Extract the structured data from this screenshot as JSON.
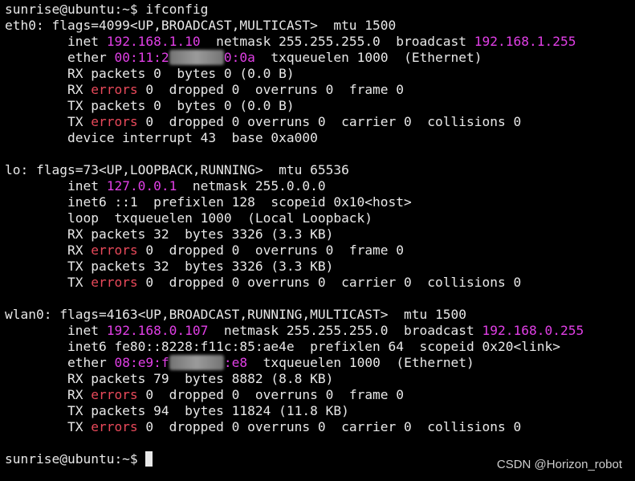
{
  "window": {
    "background": "#000000",
    "text_color": "#e8e8e8",
    "highlight_ip_color": "#e13fe6",
    "highlight_error_color": "#e8495a"
  },
  "terminal": {
    "lines": [
      [
        {
          "t": "sunrise@ubuntu:~$ ifconfig",
          "c": ""
        }
      ],
      [
        {
          "t": "eth0: flags=4099<UP,BROADCAST,MULTICAST>  mtu 1500",
          "c": ""
        }
      ],
      [
        {
          "t": "        inet ",
          "c": ""
        },
        {
          "t": "192.168.1.10",
          "c": "pink"
        },
        {
          "t": "  netmask 255.255.255.0  broadcast ",
          "c": ""
        },
        {
          "t": "192.168.1.255",
          "c": "pink"
        }
      ],
      [
        {
          "t": "        ether ",
          "c": ""
        },
        {
          "t": "00:11:2",
          "c": "pink"
        },
        {
          "t": "#######",
          "c": "redacted"
        },
        {
          "t": "0:0a",
          "c": "pink"
        },
        {
          "t": "  txqueuelen 1000  (Ethernet)",
          "c": ""
        }
      ],
      [
        {
          "t": "        RX packets 0  bytes 0 (0.0 B)",
          "c": ""
        }
      ],
      [
        {
          "t": "        RX ",
          "c": ""
        },
        {
          "t": "errors",
          "c": "red"
        },
        {
          "t": " 0  dropped 0  overruns 0  frame 0",
          "c": ""
        }
      ],
      [
        {
          "t": "        TX packets 0  bytes 0 (0.0 B)",
          "c": ""
        }
      ],
      [
        {
          "t": "        TX ",
          "c": ""
        },
        {
          "t": "errors",
          "c": "red"
        },
        {
          "t": " 0  dropped 0 overruns 0  carrier 0  collisions 0",
          "c": ""
        }
      ],
      [
        {
          "t": "        device interrupt 43  base 0xa000",
          "c": ""
        }
      ],
      [
        {
          "t": "",
          "c": ""
        }
      ],
      [
        {
          "t": "lo: flags=73<UP,LOOPBACK,RUNNING>  mtu 65536",
          "c": ""
        }
      ],
      [
        {
          "t": "        inet ",
          "c": ""
        },
        {
          "t": "127.0.0.1",
          "c": "pink"
        },
        {
          "t": "  netmask 255.0.0.0",
          "c": ""
        }
      ],
      [
        {
          "t": "        inet6 ::1  prefixlen 128  scopeid 0x10<host>",
          "c": ""
        }
      ],
      [
        {
          "t": "        loop  txqueuelen 1000  (Local Loopback)",
          "c": ""
        }
      ],
      [
        {
          "t": "        RX packets 32  bytes 3326 (3.3 KB)",
          "c": ""
        }
      ],
      [
        {
          "t": "        RX ",
          "c": ""
        },
        {
          "t": "errors",
          "c": "red"
        },
        {
          "t": " 0  dropped 0  overruns 0  frame 0",
          "c": ""
        }
      ],
      [
        {
          "t": "        TX packets 32  bytes 3326 (3.3 KB)",
          "c": ""
        }
      ],
      [
        {
          "t": "        TX ",
          "c": ""
        },
        {
          "t": "errors",
          "c": "red"
        },
        {
          "t": " 0  dropped 0 overruns 0  carrier 0  collisions 0",
          "c": ""
        }
      ],
      [
        {
          "t": "",
          "c": ""
        }
      ],
      [
        {
          "t": "wlan0: flags=4163<UP,BROADCAST,RUNNING,MULTICAST>  mtu 1500",
          "c": ""
        }
      ],
      [
        {
          "t": "        inet ",
          "c": ""
        },
        {
          "t": "192.168.0.107",
          "c": "pink"
        },
        {
          "t": "  netmask 255.255.255.0  broadcast ",
          "c": ""
        },
        {
          "t": "192.168.0.255",
          "c": "pink"
        }
      ],
      [
        {
          "t": "        inet6 fe80::8228:f11c:85:ae4e  prefixlen 64  scopeid 0x20<link>",
          "c": ""
        }
      ],
      [
        {
          "t": "        ether ",
          "c": ""
        },
        {
          "t": "08:e9:f",
          "c": "pink"
        },
        {
          "t": "#######",
          "c": "redacted"
        },
        {
          "t": ":e8",
          "c": "pink"
        },
        {
          "t": "  txqueuelen 1000  (Ethernet)",
          "c": ""
        }
      ],
      [
        {
          "t": "        RX packets 79  bytes 8882 (8.8 KB)",
          "c": ""
        }
      ],
      [
        {
          "t": "        RX ",
          "c": ""
        },
        {
          "t": "errors",
          "c": "red"
        },
        {
          "t": " 0  dropped 0  overruns 0  frame 0",
          "c": ""
        }
      ],
      [
        {
          "t": "        TX packets 94  bytes 11824 (11.8 KB)",
          "c": ""
        }
      ],
      [
        {
          "t": "        TX ",
          "c": ""
        },
        {
          "t": "errors",
          "c": "red"
        },
        {
          "t": " 0  dropped 0 overruns 0  carrier 0  collisions 0",
          "c": ""
        }
      ],
      [
        {
          "t": "",
          "c": ""
        }
      ],
      [
        {
          "t": "sunrise@ubuntu:~$ ",
          "c": ""
        }
      ]
    ],
    "cursor_icon": "block-cursor-icon"
  },
  "watermark": {
    "text": "CSDN @Horizon_robot"
  }
}
